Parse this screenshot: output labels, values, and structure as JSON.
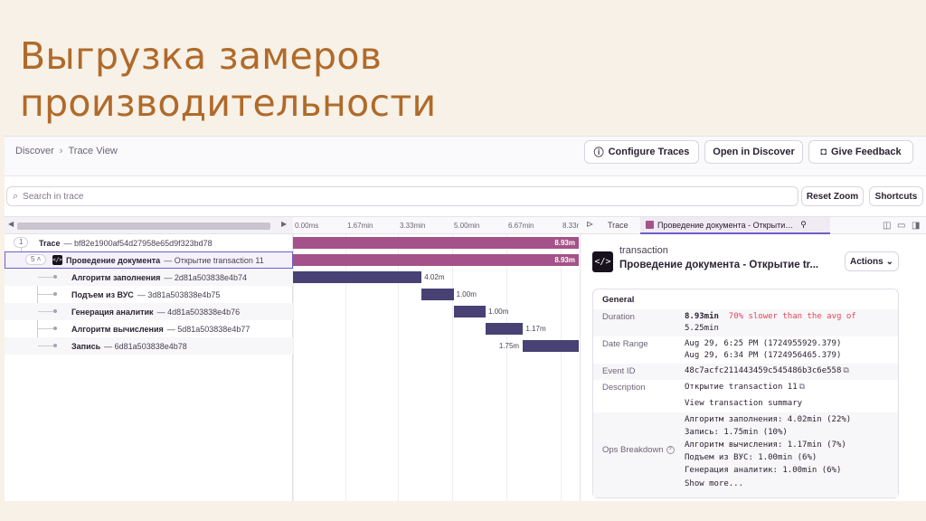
{
  "slide": {
    "title_line1": "Выгрузка замеров",
    "title_line2": "производительности"
  },
  "header": {
    "breadcrumb": [
      "Discover",
      "Trace View"
    ],
    "buttons": {
      "configure": "Configure Traces",
      "open_discover": "Open in Discover",
      "feedback": "Give Feedback"
    }
  },
  "search": {
    "placeholder": "Search in trace",
    "reset_zoom": "Reset Zoom",
    "shortcuts": "Shortcuts"
  },
  "tree": {
    "trace_count": "1",
    "trace_label": "Trace",
    "trace_id": "— bf82e1900af54d27958e65d9f323bd78",
    "tx_count": "5",
    "tx_name": "Проведение документа",
    "tx_desc": "— Открытие transaction 11",
    "spans": [
      {
        "name": "Алгоритм заполнения",
        "id": "— 2d81a503838e4b74",
        "duration": "4.02m",
        "start": 0.0,
        "len": 4.02
      },
      {
        "name": "Подъем из ВУС",
        "id": "— 3d81a503838e4b75",
        "duration": "1.00m",
        "start": 4.02,
        "len": 1.0
      },
      {
        "name": "Генерация аналитик",
        "id": "— 4d81a503838e4b76",
        "duration": "1.00m",
        "start": 5.02,
        "len": 1.0
      },
      {
        "name": "Алгоритм вычисления",
        "id": "— 5d81a503838e4b77",
        "duration": "1.17m",
        "start": 6.02,
        "len": 1.17
      },
      {
        "name": "Запись",
        "id": "— 6d81a503838e4b78",
        "duration": "1.75m",
        "start": 7.18,
        "len": 1.75
      }
    ],
    "total_duration": "8.93m"
  },
  "timeline": {
    "ticks": [
      "0.00ms",
      "1.67min",
      "3.33min",
      "5.00min",
      "6.67min",
      "8.33r"
    ],
    "max_minutes": 9.0
  },
  "details": {
    "tab_trace": "Trace",
    "tab_active": "Проведение документа - Открыти…",
    "op_label": "transaction",
    "tx_title": "Проведение документа - Открытие tr...",
    "actions_label": "Actions",
    "general_header": "General",
    "duration_key": "Duration",
    "duration_value": "8.93min",
    "duration_compare_1": "70% slower than the avg of",
    "duration_compare_2": "5.25min",
    "date_key": "Date Range",
    "date_start": "Aug 29, 6:25 PM (1724955929.379)",
    "date_end": "Aug 29, 6:34 PM (1724956465.379)",
    "event_key": "Event ID",
    "event_value": "48c7acfc211443459c545486b3c6e558",
    "desc_key": "Description",
    "desc_value": "Открытие transaction 11",
    "summary_link": "View transaction summary",
    "ops_key": "Ops Breakdown",
    "ops": [
      "Алгоритм заполнения: 4.02min (22%)",
      "Запись: 1.75min (10%)",
      "Алгоритм вычисления: 1.17min (7%)",
      "Подъем из ВУС: 1.00min (6%)",
      "Генерация аналитик: 1.00min (6%)"
    ],
    "show_more": "Show more..."
  },
  "colors": {
    "tx_bar": "#a5528a",
    "span_bar": "#474174",
    "title": "#b06a2a"
  }
}
